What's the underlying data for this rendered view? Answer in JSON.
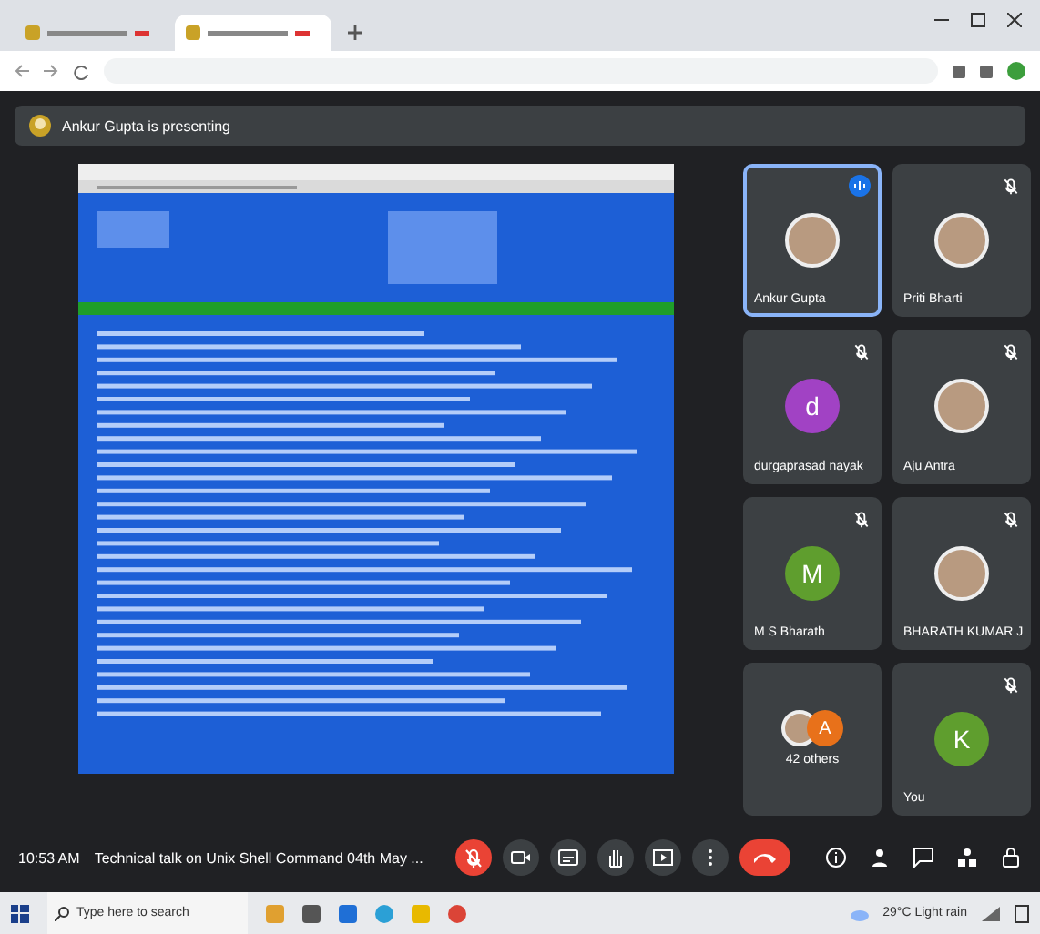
{
  "browser": {
    "tabs": [
      {
        "selected": false
      },
      {
        "selected": true
      }
    ]
  },
  "presenting_banner": {
    "text": "Ankur Gupta is presenting"
  },
  "participants": [
    {
      "name": "Ankur Gupta",
      "kind": "photo",
      "speaking": true
    },
    {
      "name": "Priti Bharti",
      "kind": "photo",
      "speaking": false,
      "muted": true
    },
    {
      "name": "durgaprasad nayak",
      "kind": "letter",
      "letter": "d",
      "color": "#a142c4",
      "speaking": false,
      "muted": true
    },
    {
      "name": "Aju Antra",
      "kind": "photo",
      "speaking": false,
      "muted": true
    },
    {
      "name": "M S Bharath",
      "kind": "letter",
      "letter": "M",
      "color": "#5f9e2e",
      "speaking": false,
      "muted": true
    },
    {
      "name": "BHARATH KUMAR J",
      "kind": "photo",
      "speaking": false,
      "muted": true
    },
    {
      "name": "42 others",
      "kind": "group",
      "letter": "A",
      "color": "#e8711a",
      "speaking": false,
      "muted": false
    },
    {
      "name": "You",
      "kind": "letter",
      "letter": "K",
      "color": "#5f9e2e",
      "speaking": false,
      "muted": true
    }
  ],
  "meeting_bar": {
    "time": "10:53 AM",
    "title": "Technical talk on Unix Shell Command 04th May ...",
    "controls": [
      {
        "kind": "mic",
        "muted": true
      },
      {
        "kind": "camera"
      },
      {
        "kind": "captions"
      },
      {
        "kind": "hand"
      },
      {
        "kind": "present"
      },
      {
        "kind": "more"
      },
      {
        "kind": "end"
      }
    ],
    "side_icons": [
      {
        "kind": "info"
      },
      {
        "kind": "people"
      },
      {
        "kind": "chat"
      },
      {
        "kind": "activities"
      },
      {
        "kind": "lock"
      }
    ]
  },
  "taskbar": {
    "search_placeholder": "Type here to search",
    "weather": "29°C Light rain"
  }
}
